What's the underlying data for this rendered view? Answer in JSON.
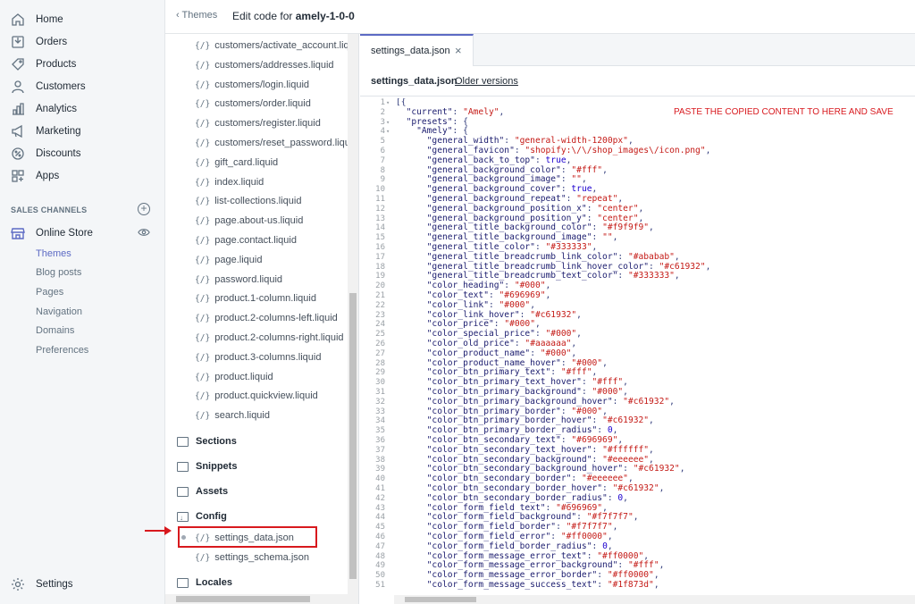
{
  "nav": {
    "items": [
      {
        "label": "Home",
        "icon": "home-icon"
      },
      {
        "label": "Orders",
        "icon": "orders-icon"
      },
      {
        "label": "Products",
        "icon": "tag-icon"
      },
      {
        "label": "Customers",
        "icon": "person-icon"
      },
      {
        "label": "Analytics",
        "icon": "bar-chart-icon"
      },
      {
        "label": "Marketing",
        "icon": "megaphone-icon"
      },
      {
        "label": "Discounts",
        "icon": "discount-icon"
      },
      {
        "label": "Apps",
        "icon": "apps-icon"
      }
    ],
    "sales_channels": "SALES CHANNELS",
    "online_store": "Online Store",
    "subitems": [
      "Themes",
      "Blog posts",
      "Pages",
      "Navigation",
      "Domains",
      "Preferences"
    ],
    "settings": "Settings"
  },
  "topbar": {
    "back": "Themes",
    "edit_prefix": "Edit code for ",
    "theme_name": "amely-1-0-0"
  },
  "tree": {
    "files": [
      "customers/activate_account.liquid",
      "customers/addresses.liquid",
      "customers/login.liquid",
      "customers/order.liquid",
      "customers/register.liquid",
      "customers/reset_password.liquid",
      "gift_card.liquid",
      "index.liquid",
      "list-collections.liquid",
      "page.about-us.liquid",
      "page.contact.liquid",
      "page.liquid",
      "password.liquid",
      "product.1-column.liquid",
      "product.2-columns-left.liquid",
      "product.2-columns-right.liquid",
      "product.3-columns.liquid",
      "product.liquid",
      "product.quickview.liquid",
      "search.liquid"
    ],
    "folders": {
      "sections": "Sections",
      "snippets": "Snippets",
      "assets": "Assets",
      "config": "Config",
      "locales": "Locales"
    },
    "config_files": [
      "settings_data.json",
      "settings_schema.json"
    ],
    "bracket": "{/}"
  },
  "editor": {
    "tab_label": "settings_data.json",
    "tab_close": "×",
    "file_name": "settings_data.json",
    "older_versions": "Older versions",
    "annotation": "PASTE THE COPIED CONTENT TO HERE AND SAVE",
    "lines": [
      "[{",
      "  \"current\": \"Amely\",",
      "  \"presets\": {",
      "    \"Amely\": {",
      "      \"general_width\": \"general-width-1200px\",",
      "      \"general_favicon\": \"shopify:\\/\\/shop_images\\/icon.png\",",
      "      \"general_back_to_top\": true,",
      "      \"general_background_color\": \"#fff\",",
      "      \"general_background_image\": \"\",",
      "      \"general_background_cover\": true,",
      "      \"general_background_repeat\": \"repeat\",",
      "      \"general_background_position_x\": \"center\",",
      "      \"general_background_position_y\": \"center\",",
      "      \"general_title_background_color\": \"#f9f9f9\",",
      "      \"general_title_background_image\": \"\",",
      "      \"general_title_color\": \"#333333\",",
      "      \"general_title_breadcrumb_link_color\": \"#ababab\",",
      "      \"general_title_breadcrumb_link_hover_color\": \"#c61932\",",
      "      \"general_title_breadcrumb_text_color\": \"#333333\",",
      "      \"color_heading\": \"#000\",",
      "      \"color_text\": \"#696969\",",
      "      \"color_link\": \"#000\",",
      "      \"color_link_hover\": \"#c61932\",",
      "      \"color_price\": \"#000\",",
      "      \"color_special_price\": \"#000\",",
      "      \"color_old_price\": \"#aaaaaa\",",
      "      \"color_product_name\": \"#000\",",
      "      \"color_product_name_hover\": \"#000\",",
      "      \"color_btn_primary_text\": \"#fff\",",
      "      \"color_btn_primary_text_hover\": \"#fff\",",
      "      \"color_btn_primary_background\": \"#000\",",
      "      \"color_btn_primary_background_hover\": \"#c61932\",",
      "      \"color_btn_primary_border\": \"#000\",",
      "      \"color_btn_primary_border_hover\": \"#c61932\",",
      "      \"color_btn_primary_border_radius\": 0,",
      "      \"color_btn_secondary_text\": \"#696969\",",
      "      \"color_btn_secondary_text_hover\": \"#ffffff\",",
      "      \"color_btn_secondary_background\": \"#eeeeee\",",
      "      \"color_btn_secondary_background_hover\": \"#c61932\",",
      "      \"color_btn_secondary_border\": \"#eeeeee\",",
      "      \"color_btn_secondary_border_hover\": \"#c61932\",",
      "      \"color_btn_secondary_border_radius\": 0,",
      "      \"color_form_field_text\": \"#696969\",",
      "      \"color_form_field_background\": \"#f7f7f7\",",
      "      \"color_form_field_border\": \"#f7f7f7\",",
      "      \"color_form_field_error\": \"#ff0000\",",
      "      \"color_form_field_border_radius\": 0,",
      "      \"color_form_message_error_text\": \"#ff0000\",",
      "      \"color_form_message_error_background\": \"#fff\",",
      "      \"color_form_message_error_border\": \"#ff0000\",",
      "      \"color_form_message_success_text\": \"#1f873d\","
    ]
  },
  "colors": {
    "accent": "#5c6ac4",
    "highlight": "#d8191e"
  }
}
